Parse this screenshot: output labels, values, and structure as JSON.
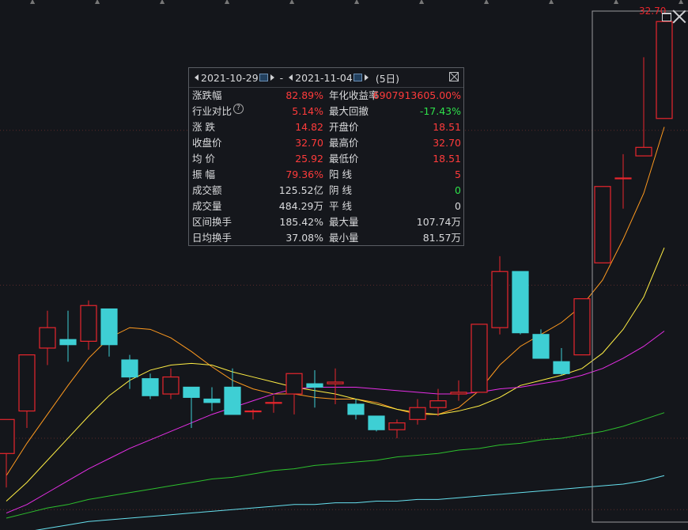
{
  "chart_data": {
    "type": "candlestick",
    "ylim": [
      3.5,
      33.5
    ],
    "candles": [
      {
        "open": 7.3,
        "high": 9.1,
        "low": 5.3,
        "close": 9.3
      },
      {
        "open": 9.8,
        "high": 13.1,
        "low": 8.8,
        "close": 13.1
      },
      {
        "open": 13.5,
        "high": 15.7,
        "low": 12.5,
        "close": 14.7
      },
      {
        "open": 14.0,
        "high": 15.7,
        "low": 12.7,
        "close": 13.7
      },
      {
        "open": 13.9,
        "high": 16.3,
        "low": 13.4,
        "close": 16.0
      },
      {
        "open": 15.8,
        "high": 15.8,
        "low": 13.0,
        "close": 13.7
      },
      {
        "open": 12.8,
        "high": 13.1,
        "low": 11.1,
        "close": 11.8
      },
      {
        "open": 11.7,
        "high": 12.0,
        "low": 10.5,
        "close": 10.7
      },
      {
        "open": 10.8,
        "high": 12.3,
        "low": 10.5,
        "close": 11.8
      },
      {
        "open": 11.2,
        "high": 11.2,
        "low": 8.8,
        "close": 10.6
      },
      {
        "open": 10.5,
        "high": 11.2,
        "low": 9.8,
        "close": 10.3
      },
      {
        "open": 11.2,
        "high": 12.3,
        "low": 9.6,
        "close": 9.6
      },
      {
        "open": 9.8,
        "high": 9.9,
        "low": 9.3,
        "close": 9.8
      },
      {
        "open": 10.3,
        "high": 10.7,
        "low": 9.7,
        "close": 10.3
      },
      {
        "open": 10.8,
        "high": 11.6,
        "low": 9.6,
        "close": 12.0
      },
      {
        "open": 11.4,
        "high": 12.2,
        "low": 10.0,
        "close": 11.2
      },
      {
        "open": 11.4,
        "high": 12.3,
        "low": 10.2,
        "close": 11.5
      },
      {
        "open": 10.2,
        "high": 10.5,
        "low": 9.3,
        "close": 9.6
      },
      {
        "open": 9.5,
        "high": 9.5,
        "low": 8.6,
        "close": 8.7
      },
      {
        "open": 8.7,
        "high": 9.3,
        "low": 8.2,
        "close": 9.1
      },
      {
        "open": 9.3,
        "high": 10.5,
        "low": 9.0,
        "close": 10.0
      },
      {
        "open": 10.0,
        "high": 11.1,
        "low": 9.5,
        "close": 10.4
      },
      {
        "open": 10.8,
        "high": 11.6,
        "low": 10.4,
        "close": 10.9
      },
      {
        "open": 10.9,
        "high": 14.9,
        "low": 10.9,
        "close": 14.9
      },
      {
        "open": 14.7,
        "high": 18.9,
        "low": 14.3,
        "close": 18.0
      },
      {
        "open": 18.0,
        "high": 17.9,
        "low": 14.3,
        "close": 14.4
      },
      {
        "open": 14.3,
        "high": 14.6,
        "low": 12.9,
        "close": 12.9
      },
      {
        "open": 12.7,
        "high": 13.5,
        "low": 11.9,
        "close": 12.0
      },
      {
        "open": 13.1,
        "high": 16.4,
        "low": 13.1,
        "close": 16.4
      },
      {
        "open": 18.51,
        "high": 23.0,
        "low": 18.6,
        "close": 23.0
      },
      {
        "open": 23.5,
        "high": 24.9,
        "low": 21.7,
        "close": 23.5
      },
      {
        "open": 24.8,
        "high": 30.6,
        "low": 24.8,
        "close": 25.3
      },
      {
        "open": 27.0,
        "high": 32.7,
        "low": 27.0,
        "close": 32.7
      }
    ],
    "moving_averages": [
      {
        "color": "#ff9a1f",
        "values": [
          6.0,
          7.9,
          9.6,
          11.3,
          12.9,
          14.1,
          14.7,
          14.6,
          14.1,
          13.3,
          12.4,
          11.6,
          11.1,
          10.8,
          10.8,
          10.6,
          10.5,
          10.5,
          10.3,
          9.9,
          9.6,
          9.6,
          10.0,
          11.0,
          12.5,
          13.6,
          14.3,
          15.0,
          16.0,
          17.5,
          19.9,
          22.6,
          26.5
        ]
      },
      {
        "color": "#ffee44",
        "values": [
          4.5,
          5.6,
          6.9,
          8.2,
          9.5,
          10.7,
          11.6,
          12.2,
          12.5,
          12.6,
          12.5,
          12.1,
          11.8,
          11.5,
          11.2,
          11.0,
          10.8,
          10.5,
          10.2,
          9.9,
          9.7,
          9.6,
          9.8,
          10.1,
          10.6,
          11.3,
          11.6,
          11.9,
          12.3,
          13.2,
          14.6,
          16.5,
          19.4
        ]
      },
      {
        "color": "#e62ee6",
        "values": [
          3.8,
          4.3,
          5.0,
          5.7,
          6.4,
          7.0,
          7.6,
          8.1,
          8.6,
          9.1,
          9.6,
          10.0,
          10.4,
          10.8,
          11.1,
          11.2,
          11.2,
          11.2,
          11.1,
          11.0,
          10.9,
          10.8,
          10.8,
          10.9,
          11.1,
          11.2,
          11.4,
          11.6,
          11.9,
          12.3,
          12.9,
          13.6,
          14.5
        ]
      },
      {
        "color": "#2dbf2d",
        "values": [
          3.5,
          3.8,
          4.1,
          4.3,
          4.6,
          4.8,
          5.0,
          5.2,
          5.4,
          5.6,
          5.8,
          5.9,
          6.1,
          6.3,
          6.4,
          6.6,
          6.7,
          6.8,
          6.9,
          7.1,
          7.2,
          7.3,
          7.5,
          7.6,
          7.8,
          7.9,
          8.1,
          8.2,
          8.4,
          8.6,
          8.9,
          9.3,
          9.7
        ]
      },
      {
        "color": "#66e0ee",
        "values": [
          2.5,
          2.7,
          2.9,
          3.1,
          3.3,
          3.4,
          3.5,
          3.6,
          3.7,
          3.8,
          3.9,
          4.0,
          4.1,
          4.2,
          4.3,
          4.3,
          4.4,
          4.4,
          4.5,
          4.5,
          4.6,
          4.6,
          4.7,
          4.8,
          4.9,
          5.0,
          5.1,
          5.2,
          5.3,
          5.4,
          5.5,
          5.7,
          6.0
        ]
      }
    ],
    "max_label": "32.70",
    "selection_range": [
      29,
      33
    ]
  },
  "panel": {
    "date_from": "2021-10-29",
    "date_to": "2021-11-04",
    "sep": "-",
    "days": "(5日)",
    "rows": [
      {
        "l1": "涨跌幅",
        "v1": "82.89%",
        "c1": "red",
        "l2": "年化收益率",
        "v2": "6907913605.00%",
        "c2": "red"
      },
      {
        "l1": "行业对比",
        "v1": "5.14%",
        "c1": "red",
        "l2": "最大回撤",
        "v2": "-17.43%",
        "c2": "green"
      },
      {
        "l1": "涨 跌",
        "v1": "14.82",
        "c1": "red",
        "l2": "开盘价",
        "v2": "18.51",
        "c2": "red"
      },
      {
        "l1": "收盘价",
        "v1": "32.70",
        "c1": "red",
        "l2": "最高价",
        "v2": "32.70",
        "c2": "red"
      },
      {
        "l1": "均 价",
        "v1": "25.92",
        "c1": "red",
        "l2": "最低价",
        "v2": "18.51",
        "c2": "red"
      },
      {
        "l1": "振 幅",
        "v1": "79.36%",
        "c1": "red",
        "l2": "阳 线",
        "v2": "5",
        "c2": "red"
      },
      {
        "l1": "成交额",
        "v1": "125.52亿",
        "c1": "white",
        "l2": "阴 线",
        "v2": "0",
        "c2": "green"
      },
      {
        "l1": "成交量",
        "v1": "484.29万",
        "c1": "white",
        "l2": "平 线",
        "v2": "0",
        "c2": "white"
      },
      {
        "l1": "区间换手",
        "v1": "185.42%",
        "c1": "white",
        "l2": "最大量",
        "v2": "107.74万",
        "c2": "white"
      },
      {
        "l1": "日均换手",
        "v1": "37.08%",
        "c1": "white",
        "l2": "最小量",
        "v2": "81.57万",
        "c2": "white"
      }
    ]
  }
}
